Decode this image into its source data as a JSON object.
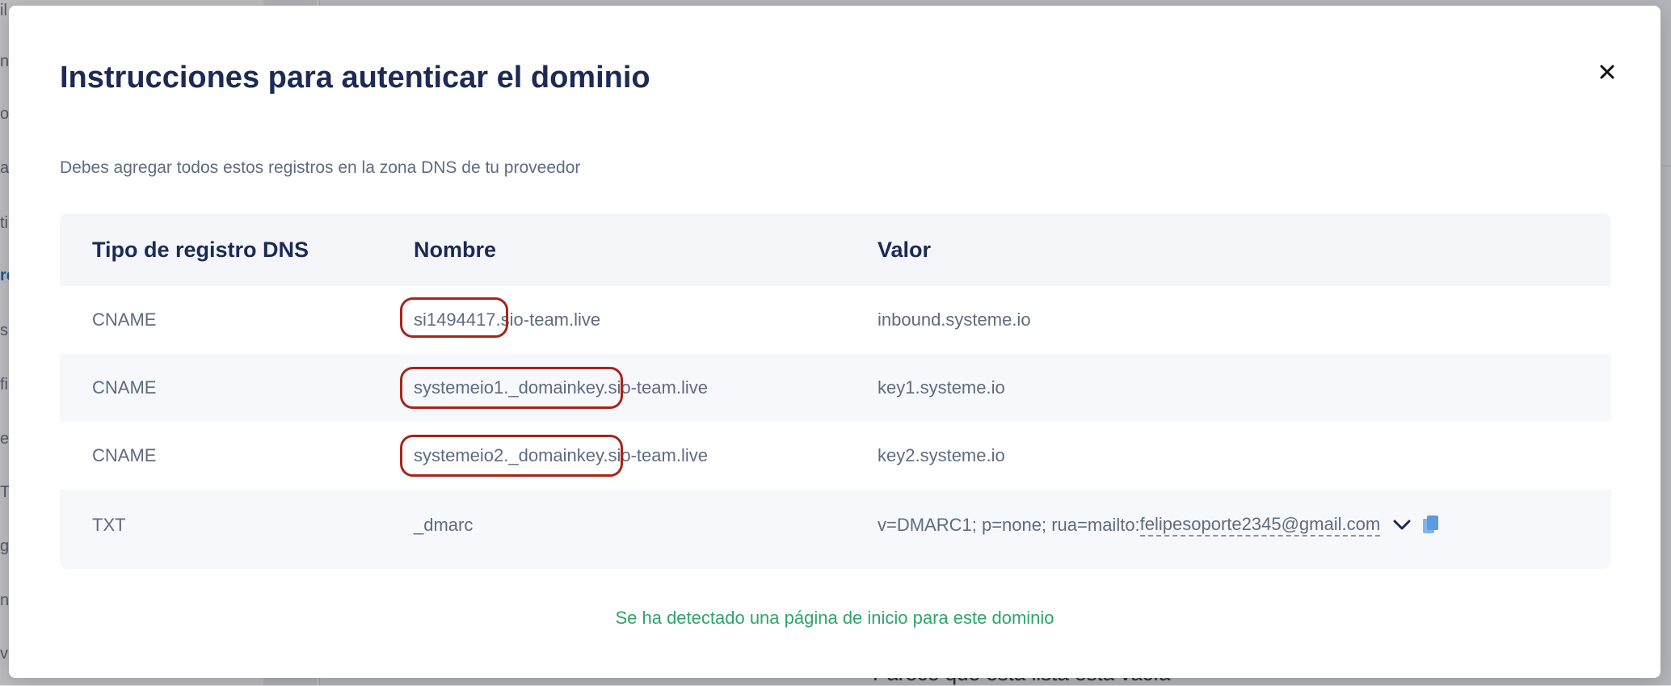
{
  "modal": {
    "title": "Instrucciones para autenticar el dominio",
    "subtitle": "Debes agregar todos estos registros en la zona DNS de tu proveedor",
    "close_icon": "close-icon",
    "detected_message": "Se ha detectado una página de inicio para este dominio"
  },
  "table": {
    "headers": [
      "Tipo de registro DNS",
      "Nombre",
      "Valor"
    ],
    "rows": [
      {
        "type": "CNAME",
        "name": "si1494417.sio-team.live",
        "value": "inbound.systeme.io"
      },
      {
        "type": "CNAME",
        "name": "systemeio1._domainkey.sio-team.live",
        "value": "key1.systeme.io"
      },
      {
        "type": "CNAME",
        "name": "systemeio2._domainkey.sio-team.live",
        "value": "key2.systeme.io"
      },
      {
        "type": "TXT",
        "name": "_dmarc",
        "value_prefix": "v=DMARC1; p=none; rua=mailto:",
        "value_email": "felipesoporte2345@gmail.com"
      }
    ],
    "expand_icon": "chevron-down-icon",
    "copy_icon": "copy-icon"
  },
  "colors": {
    "title": "#1c2a55",
    "body_text": "#5f6b80",
    "success": "#2fa36b",
    "highlight": "#a6251b",
    "copy_icon": "#5b9be6"
  },
  "background": {
    "sidebar_fragments": [
      "il",
      "n",
      "ol",
      "a",
      "ti",
      "re",
      "sc",
      "fi",
      "e",
      "To",
      "gi",
      "ni",
      "ve"
    ],
    "footer_text": "Parece que esta lista está vacía"
  }
}
